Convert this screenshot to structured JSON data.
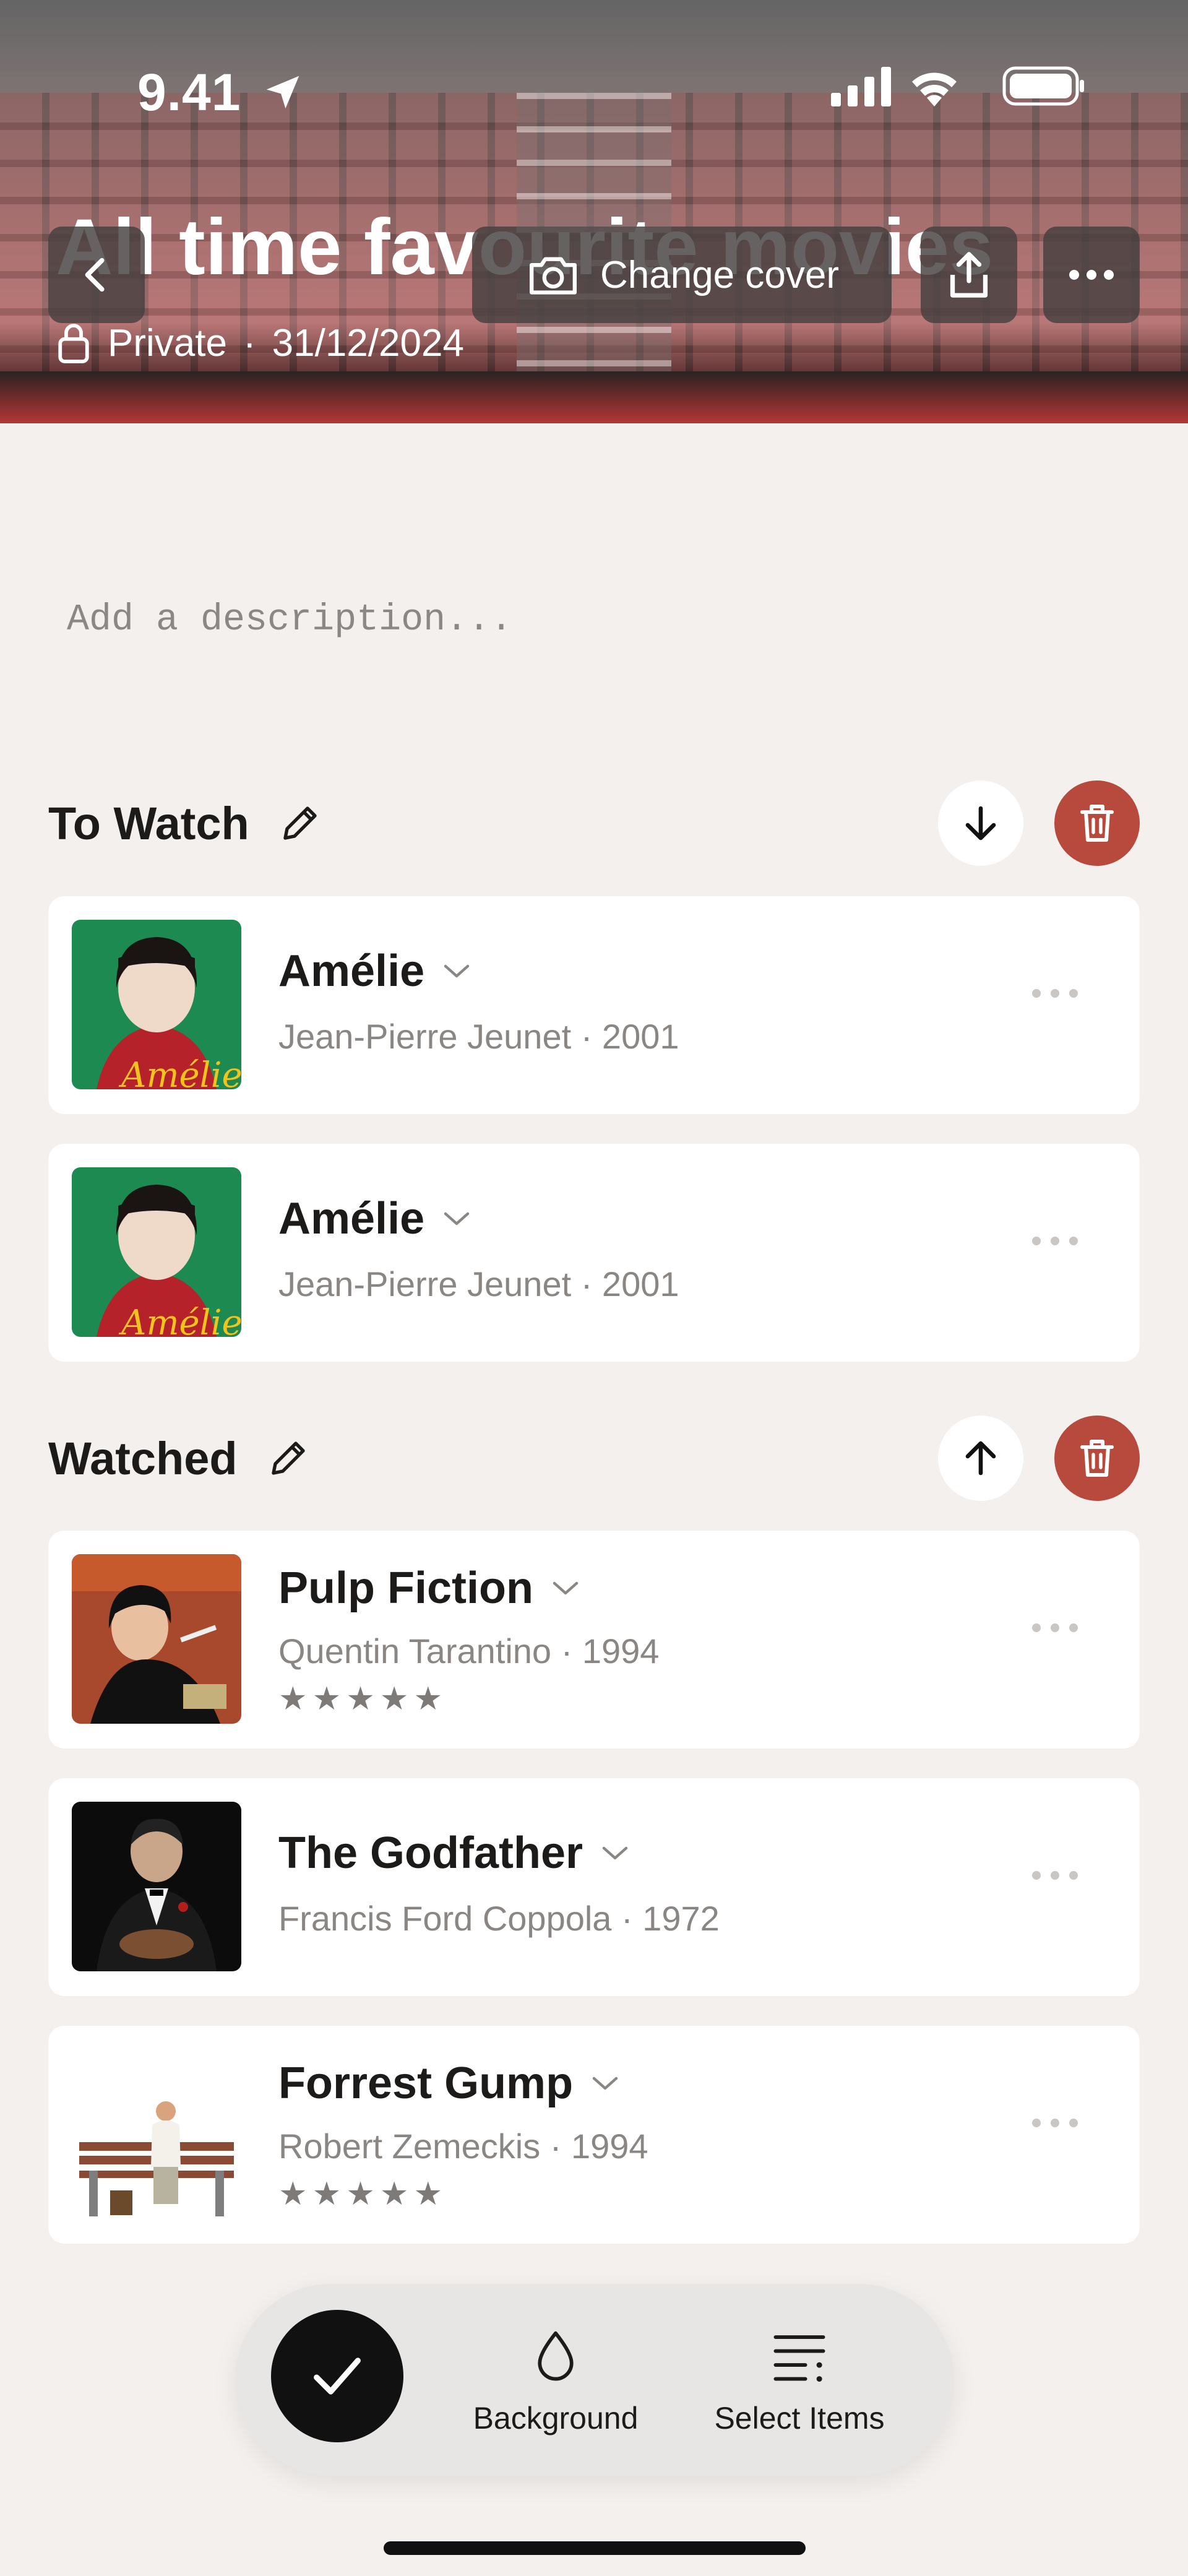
{
  "status_bar": {
    "time": "9.41"
  },
  "header": {
    "title": "All time favourite movies",
    "privacy": "Private",
    "date": "31/12/2024",
    "change_cover_label": "Change cover"
  },
  "description": {
    "placeholder": "Add a description..."
  },
  "sections": [
    {
      "title": "To Watch",
      "items": [
        {
          "title": "Amélie",
          "subtitle": "Jean-Pierre Jeunet · 2001"
        },
        {
          "title": "Amélie",
          "subtitle": "Jean-Pierre Jeunet · 2001"
        }
      ]
    },
    {
      "title": "Watched",
      "items": [
        {
          "title": "Pulp Fiction",
          "subtitle": "Quentin Tarantino · 1994",
          "rating": "★★★★★"
        },
        {
          "title": "The Godfather",
          "subtitle": "Francis Ford Coppola · 1972"
        },
        {
          "title": "Forrest Gump",
          "subtitle": "Robert Zemeckis · 1994",
          "rating": "★★★★★"
        }
      ]
    }
  ],
  "toolbar": {
    "background_label": "Background",
    "select_items_label": "Select Items"
  },
  "colors": {
    "page_bg": "#f3f0ee",
    "delete_red": "#b74a3d",
    "toolbar_bg": "#e8e6e5"
  }
}
